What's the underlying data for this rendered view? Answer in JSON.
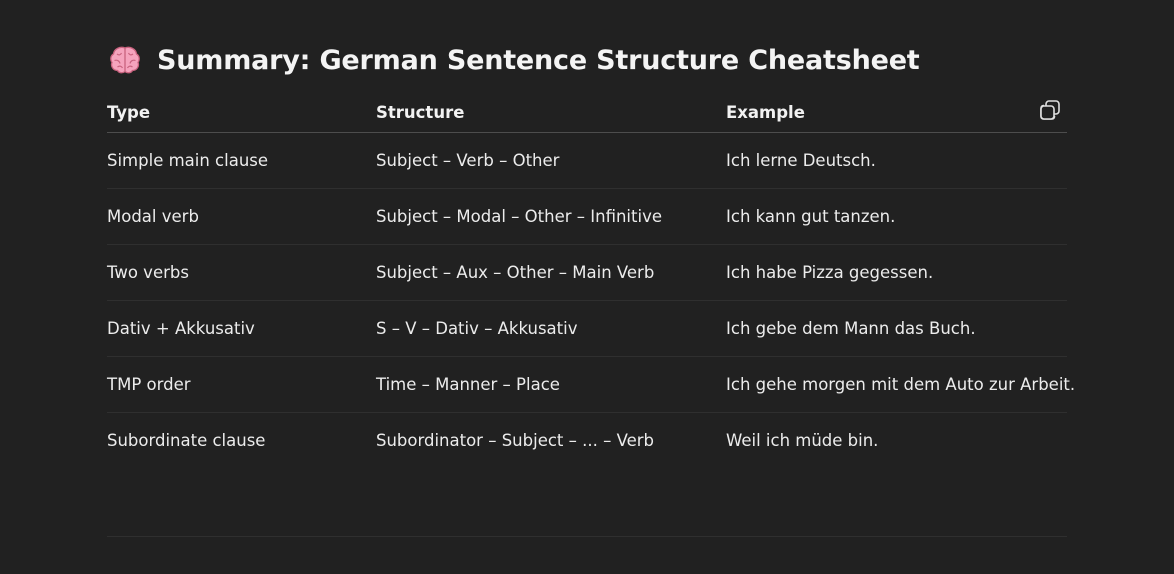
{
  "title": "Summary: German Sentence Structure Cheatsheet",
  "title_icon": "brain-emoji",
  "copy_icon": "copy-icon",
  "table": {
    "headers": [
      "Type",
      "Structure",
      "Example"
    ],
    "rows": [
      [
        "Simple main clause",
        "Subject – Verb – Other",
        "Ich lerne Deutsch."
      ],
      [
        "Modal verb",
        "Subject – Modal – Other – Infinitive",
        "Ich kann gut tanzen."
      ],
      [
        "Two verbs",
        "Subject – Aux – Other – Main Verb",
        "Ich habe Pizza gegessen."
      ],
      [
        "Dativ + Akkusativ",
        "S – V – Dativ – Akkusativ",
        "Ich gebe dem Mann das Buch."
      ],
      [
        "TMP order",
        "Time – Manner – Place",
        "Ich gehe morgen mit dem Auto zur Arbeit."
      ],
      [
        "Subordinate clause",
        "Subordinator – Subject – ... – Verb",
        "Weil ich müde bin."
      ]
    ]
  },
  "colors": {
    "background": "#212121",
    "text": "#ececec",
    "divider": "#2f2f2f",
    "header_divider": "#4d4d4d"
  }
}
